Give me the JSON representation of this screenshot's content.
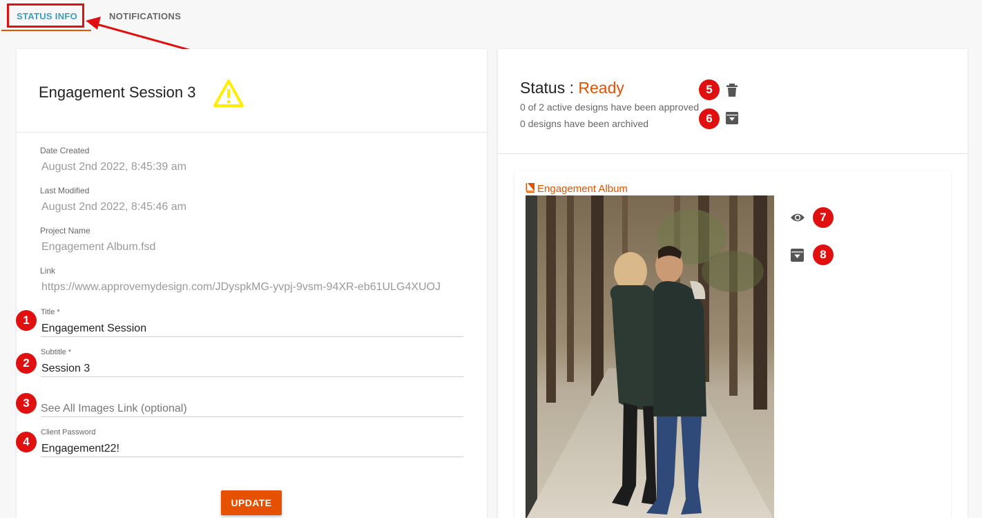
{
  "tabs": {
    "status_info": "STATUS INFO",
    "notifications": "NOTIFICATIONS"
  },
  "left": {
    "session_title": "Engagement Session 3",
    "date_created_label": "Date Created",
    "date_created_value": "August 2nd 2022, 8:45:39 am",
    "last_modified_label": "Last Modified",
    "last_modified_value": "August 2nd 2022, 8:45:46 am",
    "project_name_label": "Project Name",
    "project_name_value": "Engagement Album.fsd",
    "link_label": "Link",
    "link_value": "https://www.approvemydesign.com/JDyspkMG-yvpj-9vsm-94XR-eb61ULG4XUOJ",
    "title_label": "Title *",
    "title_value": "Engagement Session",
    "subtitle_label": "Subtitle *",
    "subtitle_value": "Session 3",
    "see_all_placeholder": "See All Images Link (optional)",
    "password_label": "Client Password",
    "password_value": "Engagement22!",
    "update_label": "UPDATE"
  },
  "right": {
    "status_prefix": "Status : ",
    "status_value": "Ready",
    "approved_text": "0 of 2 active designs have been approved",
    "archived_text": "0 designs have been archived",
    "design_title": "Engagement Album"
  },
  "badges": [
    "1",
    "2",
    "3",
    "4",
    "5",
    "6",
    "7",
    "8"
  ],
  "icons": [
    "warning-icon",
    "trash-icon",
    "archive-icon",
    "book-icon",
    "eye-icon"
  ],
  "colors": {
    "accent": "#e65100",
    "tab_active": "#3a9fbf",
    "annotation": "#e01010",
    "warning": "#ffee00"
  }
}
